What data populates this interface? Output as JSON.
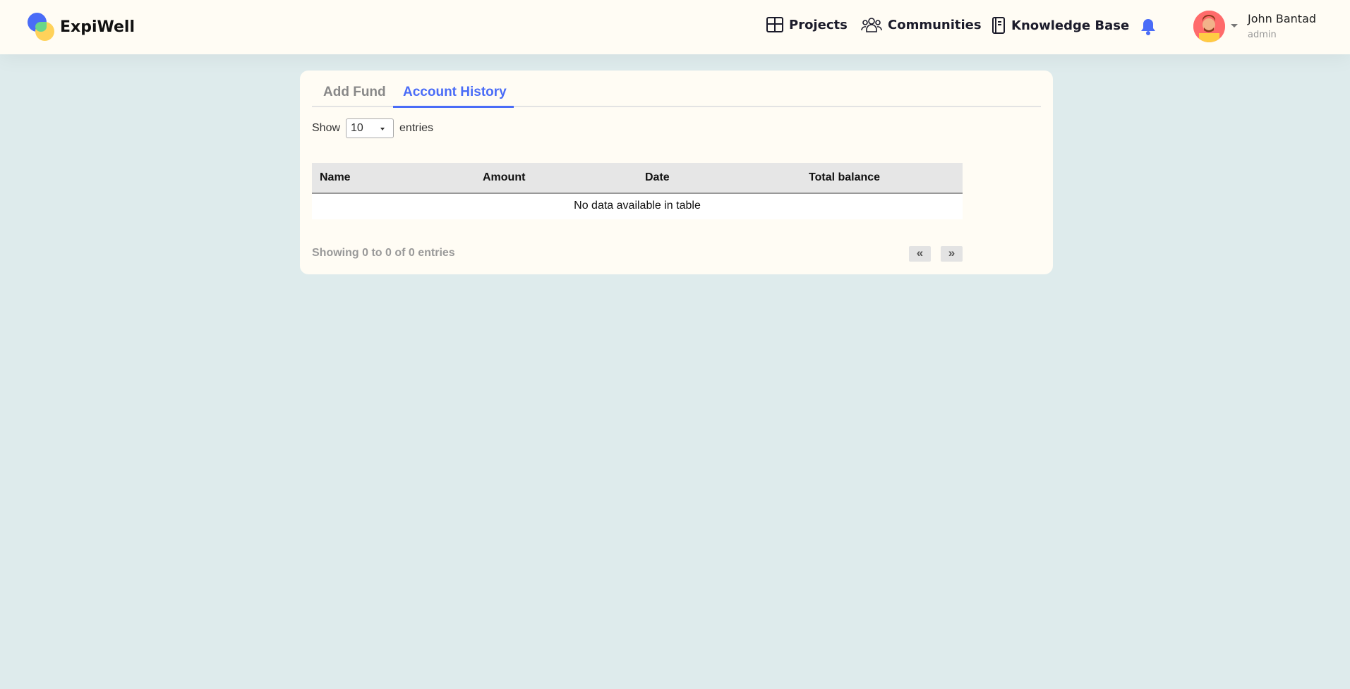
{
  "header": {
    "brand": "ExpiWell",
    "nav": [
      {
        "label": "Projects",
        "icon": "grid-icon"
      },
      {
        "label": "Communities",
        "icon": "users-icon"
      },
      {
        "label": "Knowledge Base",
        "icon": "book-icon"
      }
    ],
    "user": {
      "name": "John Bantad",
      "role": "admin"
    }
  },
  "tabs": [
    {
      "label": "Add Fund",
      "active": false
    },
    {
      "label": "Account History",
      "active": true
    }
  ],
  "length": {
    "prefix": "Show",
    "value": "10",
    "suffix": "entries"
  },
  "table": {
    "columns": [
      "Name",
      "Amount",
      "Date",
      "Total balance"
    ],
    "empty": "No data available in table"
  },
  "info": "Showing 0 to 0 of 0 entries",
  "pagination": {
    "prev": "«",
    "next": "»"
  },
  "colors": {
    "accent": "#4a6cf7",
    "background": "#deebec",
    "card": "#fffcf4"
  }
}
